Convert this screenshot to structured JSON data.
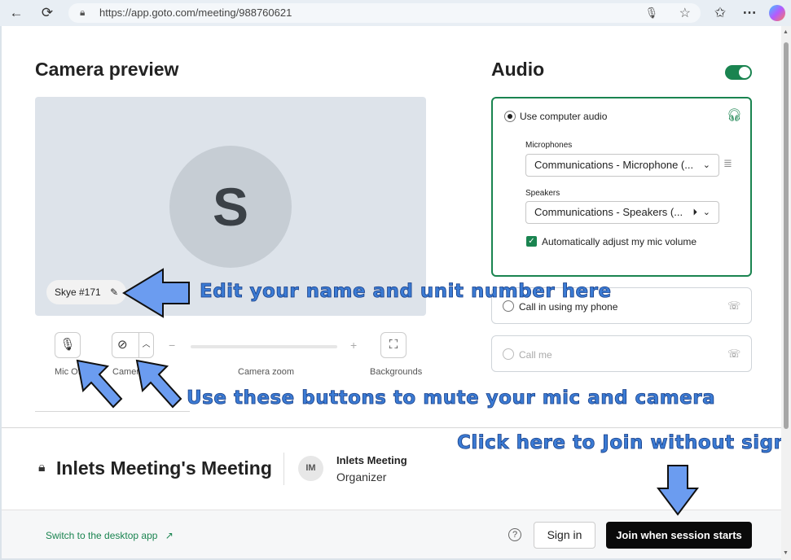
{
  "browser": {
    "url": "https://app.goto.com/meeting/988760621"
  },
  "camera": {
    "heading": "Camera preview",
    "avatar_initial": "S",
    "display_name": "Skye #171",
    "mic_label": "Mic Off",
    "camera_label": "Camera",
    "zoom_label": "Camera zoom",
    "backgrounds_label": "Backgrounds",
    "zoom_minus": "−",
    "zoom_plus": "+"
  },
  "audio": {
    "heading": "Audio",
    "enabled": true,
    "use_computer_audio": "Use computer audio",
    "microphones_label": "Microphones",
    "microphone_value": "Communications - Microphone (...",
    "speakers_label": "Speakers",
    "speaker_value": "Communications - Speakers (...",
    "auto_adjust": "Automatically adjust my mic volume",
    "call_in": "Call in using my phone",
    "call_me": "Call me"
  },
  "meeting": {
    "title": "Inlets Meeting's Meeting",
    "organizer_initials": "IM",
    "organizer_name": "Inlets Meeting",
    "organizer_role": "Organizer"
  },
  "footer": {
    "desktop_link": "Switch to the desktop app",
    "sign_in": "Sign in",
    "join": "Join when session starts"
  },
  "annotations": {
    "name_tip": "Edit your name and unit number here",
    "buttons_tip": "Use these buttons to mute your mic and camera",
    "join_tip": "Click here to Join without signing in"
  },
  "colors": {
    "accent": "#1a8450",
    "annotation": "#3b7bd4"
  }
}
